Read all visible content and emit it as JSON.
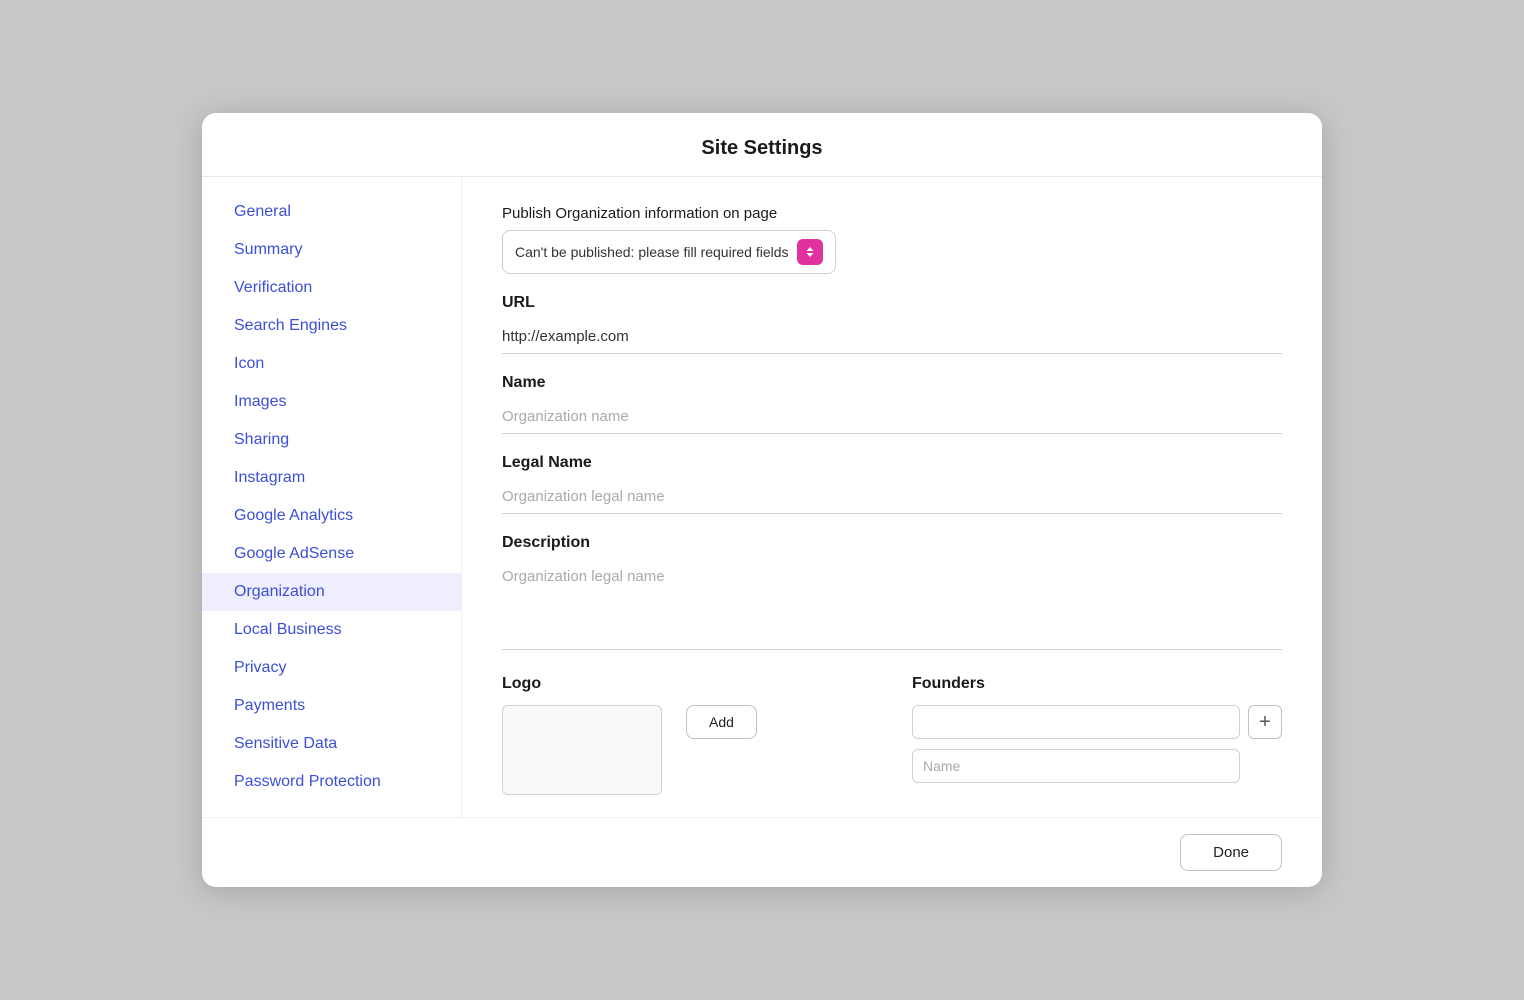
{
  "modal": {
    "title": "Site Settings"
  },
  "sidebar": {
    "items": [
      {
        "id": "general",
        "label": "General",
        "active": false
      },
      {
        "id": "summary",
        "label": "Summary",
        "active": false
      },
      {
        "id": "verification",
        "label": "Verification",
        "active": false
      },
      {
        "id": "search-engines",
        "label": "Search Engines",
        "active": false
      },
      {
        "id": "icon",
        "label": "Icon",
        "active": false
      },
      {
        "id": "images",
        "label": "Images",
        "active": false
      },
      {
        "id": "sharing",
        "label": "Sharing",
        "active": false
      },
      {
        "id": "instagram",
        "label": "Instagram",
        "active": false
      },
      {
        "id": "google-analytics",
        "label": "Google Analytics",
        "active": false
      },
      {
        "id": "google-adsense",
        "label": "Google AdSense",
        "active": false
      },
      {
        "id": "organization",
        "label": "Organization",
        "active": true
      },
      {
        "id": "local-business",
        "label": "Local Business",
        "active": false
      },
      {
        "id": "privacy",
        "label": "Privacy",
        "active": false
      },
      {
        "id": "payments",
        "label": "Payments",
        "active": false
      },
      {
        "id": "sensitive-data",
        "label": "Sensitive Data",
        "active": false
      },
      {
        "id": "password-protection",
        "label": "Password Protection",
        "active": false
      }
    ]
  },
  "content": {
    "publish_label": "Publish Organization information on page",
    "publish_select_text": "Can't be published: please fill required fields",
    "url_label": "URL",
    "url_value": "http://example.com",
    "name_label": "Name",
    "name_placeholder": "Organization name",
    "legal_name_label": "Legal Name",
    "legal_name_placeholder": "Organization legal name",
    "description_label": "Description",
    "description_placeholder": "Organization legal name",
    "logo_label": "Logo",
    "add_button": "Add",
    "founders_label": "Founders",
    "founders_input_placeholder": "",
    "founders_name_placeholder": "Name",
    "done_button": "Done"
  }
}
